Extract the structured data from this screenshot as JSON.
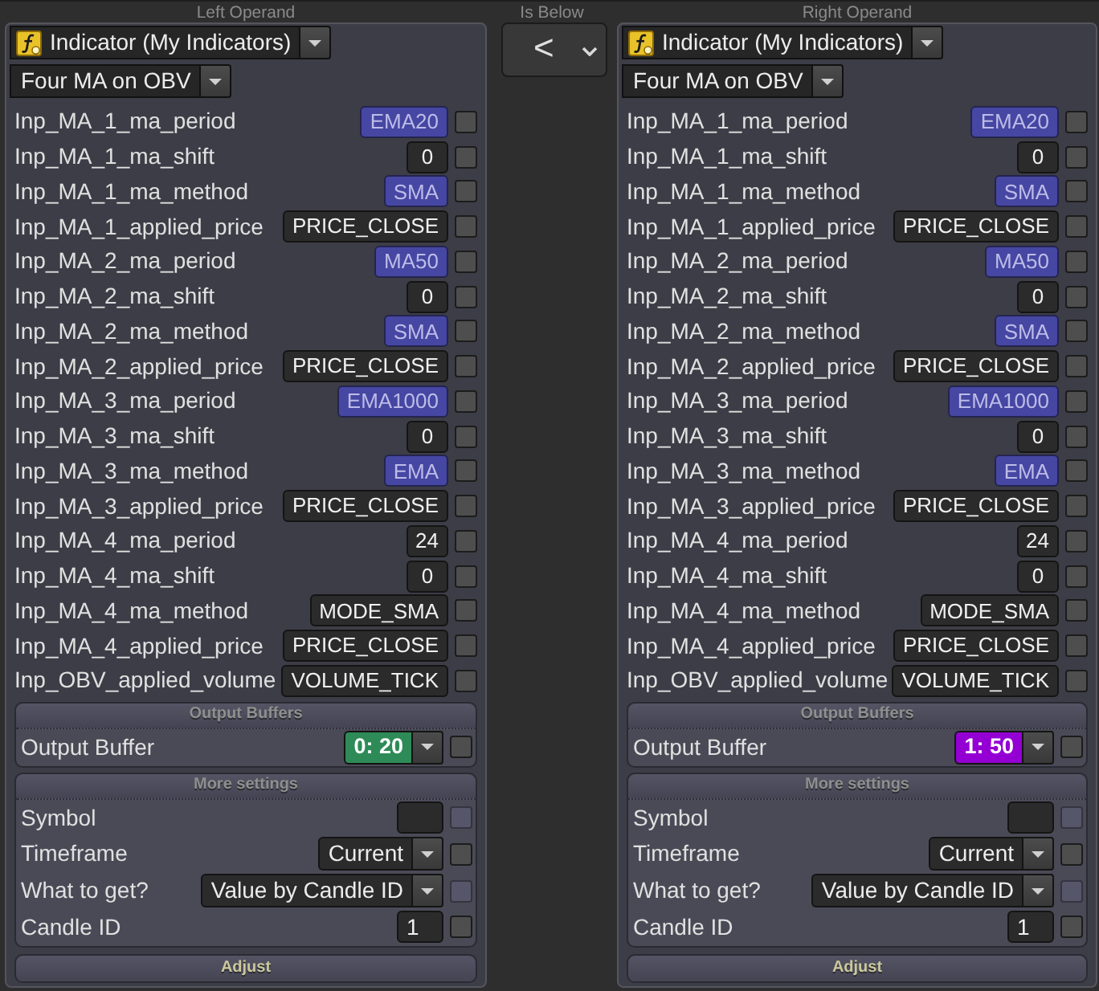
{
  "left_operand": {
    "title": "Left Operand",
    "source": "Indicator (My Indicators)",
    "indicator": "Four MA on OBV",
    "params": [
      {
        "label": "Inp_MA_1_ma_period",
        "value": "EMA20",
        "highlighted": true,
        "checked": false
      },
      {
        "label": "Inp_MA_1_ma_shift",
        "value": "0",
        "highlighted": false,
        "checked": false
      },
      {
        "label": "Inp_MA_1_ma_method",
        "value": "SMA",
        "highlighted": true,
        "checked": false
      },
      {
        "label": "Inp_MA_1_applied_price",
        "value": "PRICE_CLOSE",
        "highlighted": false,
        "checked": false
      },
      {
        "label": "Inp_MA_2_ma_period",
        "value": "MA50",
        "highlighted": true,
        "checked": false
      },
      {
        "label": "Inp_MA_2_ma_shift",
        "value": "0",
        "highlighted": false,
        "checked": false
      },
      {
        "label": "Inp_MA_2_ma_method",
        "value": "SMA",
        "highlighted": true,
        "checked": false
      },
      {
        "label": "Inp_MA_2_applied_price",
        "value": "PRICE_CLOSE",
        "highlighted": false,
        "checked": false
      },
      {
        "label": "Inp_MA_3_ma_period",
        "value": "EMA1000",
        "highlighted": true,
        "checked": false
      },
      {
        "label": "Inp_MA_3_ma_shift",
        "value": "0",
        "highlighted": false,
        "checked": false
      },
      {
        "label": "Inp_MA_3_ma_method",
        "value": "EMA",
        "highlighted": true,
        "checked": false
      },
      {
        "label": "Inp_MA_3_applied_price",
        "value": "PRICE_CLOSE",
        "highlighted": false,
        "checked": false
      },
      {
        "label": "Inp_MA_4_ma_period",
        "value": "24",
        "highlighted": false,
        "checked": false
      },
      {
        "label": "Inp_MA_4_ma_shift",
        "value": "0",
        "highlighted": false,
        "checked": false
      },
      {
        "label": "Inp_MA_4_ma_method",
        "value": "MODE_SMA",
        "highlighted": false,
        "checked": false
      },
      {
        "label": "Inp_MA_4_applied_price",
        "value": "PRICE_CLOSE",
        "highlighted": false,
        "checked": false
      },
      {
        "label": "Inp_OBV_applied_volume",
        "value": "VOLUME_TICK",
        "highlighted": false,
        "checked": false
      }
    ],
    "sections": [
      {
        "title": "Output Buffers",
        "expanded": true,
        "rows": [
          {
            "kind": "select",
            "label": "Output Buffer",
            "value": "0: 20",
            "color": "#2e8b57",
            "checked": false,
            "check_disabled": false
          }
        ]
      },
      {
        "title": "More settings",
        "expanded": true,
        "rows": [
          {
            "kind": "input",
            "label": "Symbol",
            "checked": false,
            "check_disabled": true
          },
          {
            "kind": "select",
            "label": "Timeframe",
            "value": "Current",
            "checked": false,
            "check_disabled": false
          },
          {
            "kind": "select",
            "label": "What to get?",
            "value": "Value by Candle ID",
            "checked": false,
            "check_disabled": true
          },
          {
            "kind": "input",
            "label": "Candle ID",
            "value": "1",
            "checked": false,
            "check_disabled": false
          }
        ]
      },
      {
        "title": "Adjust",
        "expanded": false
      }
    ]
  },
  "comparator": {
    "title": "Is Below",
    "symbol": "<"
  },
  "right_operand": {
    "title": "Right Operand",
    "source": "Indicator (My Indicators)",
    "indicator": "Four MA on OBV",
    "params": [
      {
        "label": "Inp_MA_1_ma_period",
        "value": "EMA20",
        "highlighted": true,
        "checked": false
      },
      {
        "label": "Inp_MA_1_ma_shift",
        "value": "0",
        "highlighted": false,
        "checked": false
      },
      {
        "label": "Inp_MA_1_ma_method",
        "value": "SMA",
        "highlighted": true,
        "checked": false
      },
      {
        "label": "Inp_MA_1_applied_price",
        "value": "PRICE_CLOSE",
        "highlighted": false,
        "checked": false
      },
      {
        "label": "Inp_MA_2_ma_period",
        "value": "MA50",
        "highlighted": true,
        "checked": false
      },
      {
        "label": "Inp_MA_2_ma_shift",
        "value": "0",
        "highlighted": false,
        "checked": false
      },
      {
        "label": "Inp_MA_2_ma_method",
        "value": "SMA",
        "highlighted": true,
        "checked": false
      },
      {
        "label": "Inp_MA_2_applied_price",
        "value": "PRICE_CLOSE",
        "highlighted": false,
        "checked": false
      },
      {
        "label": "Inp_MA_3_ma_period",
        "value": "EMA1000",
        "highlighted": true,
        "checked": false
      },
      {
        "label": "Inp_MA_3_ma_shift",
        "value": "0",
        "highlighted": false,
        "checked": false
      },
      {
        "label": "Inp_MA_3_ma_method",
        "value": "EMA",
        "highlighted": true,
        "checked": false
      },
      {
        "label": "Inp_MA_3_applied_price",
        "value": "PRICE_CLOSE",
        "highlighted": false,
        "checked": false
      },
      {
        "label": "Inp_MA_4_ma_period",
        "value": "24",
        "highlighted": false,
        "checked": false
      },
      {
        "label": "Inp_MA_4_ma_shift",
        "value": "0",
        "highlighted": false,
        "checked": false
      },
      {
        "label": "Inp_MA_4_ma_method",
        "value": "MODE_SMA",
        "highlighted": false,
        "checked": false
      },
      {
        "label": "Inp_MA_4_applied_price",
        "value": "PRICE_CLOSE",
        "highlighted": false,
        "checked": false
      },
      {
        "label": "Inp_OBV_applied_volume",
        "value": "VOLUME_TICK",
        "highlighted": false,
        "checked": false
      }
    ],
    "sections": [
      {
        "title": "Output Buffers",
        "expanded": true,
        "rows": [
          {
            "kind": "select",
            "label": "Output Buffer",
            "value": "1: 50",
            "color": "#9400d3",
            "checked": false,
            "check_disabled": false
          }
        ]
      },
      {
        "title": "More settings",
        "expanded": true,
        "rows": [
          {
            "kind": "input",
            "label": "Symbol",
            "checked": false,
            "check_disabled": true
          },
          {
            "kind": "select",
            "label": "Timeframe",
            "value": "Current",
            "checked": false,
            "check_disabled": false
          },
          {
            "kind": "select",
            "label": "What to get?",
            "value": "Value by Candle ID",
            "checked": false,
            "check_disabled": true
          },
          {
            "kind": "input",
            "label": "Candle ID",
            "value": "1",
            "checked": false,
            "check_disabled": false
          }
        ]
      },
      {
        "title": "Adjust",
        "expanded": false
      }
    ]
  }
}
